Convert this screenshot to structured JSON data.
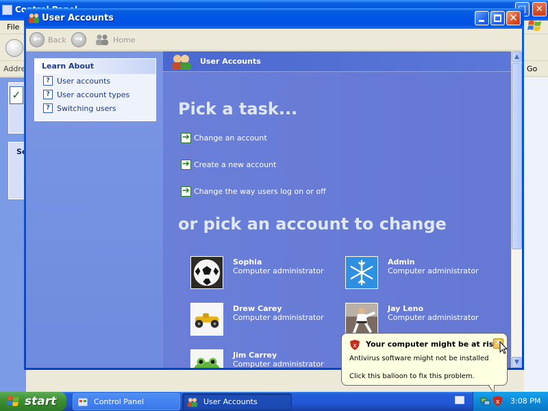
{
  "background_window": {
    "title": "Control Panel",
    "menu_file": "File",
    "address_label": "Address",
    "go_label": "Go",
    "section_prefix": "Se"
  },
  "window": {
    "title": "User Accounts",
    "nav": {
      "back": "Back",
      "home": "Home"
    }
  },
  "learn_about": {
    "heading": "Learn About",
    "items": [
      {
        "label": "User accounts"
      },
      {
        "label": "User account types"
      },
      {
        "label": "Switching users"
      }
    ]
  },
  "main": {
    "header": "User Accounts",
    "pick_task": "Pick a task...",
    "tasks": [
      {
        "label": "Change an account"
      },
      {
        "label": "Create a new account"
      },
      {
        "label": "Change the way users log on or off"
      }
    ],
    "pick_account": "or pick an account to change",
    "accounts": [
      {
        "name": "Sophia",
        "role": "Computer administrator",
        "picture": "soccer-ball-icon"
      },
      {
        "name": "Admin",
        "role": "Computer administrator",
        "picture": "snowflake-icon"
      },
      {
        "name": "Drew Carey",
        "role": "Computer administrator",
        "picture": "race-car-icon"
      },
      {
        "name": "Jay Leno",
        "role": "Computer administrator",
        "picture": "karate-icon"
      },
      {
        "name": "Jim Carrey",
        "role": "Computer administrator",
        "picture": "frog-icon"
      }
    ]
  },
  "balloon": {
    "title": "Your computer might be at risk",
    "line1": "Antivirus software might not be installed",
    "line2": "Click this balloon to fix this problem."
  },
  "taskbar": {
    "start": "start",
    "items": [
      {
        "label": "Control Panel"
      },
      {
        "label": "User Accounts"
      }
    ],
    "clock": "3:08 PM"
  },
  "colors": {
    "xp_blue": "#0055e5",
    "pane_blue": "#6a7fd8",
    "link_blue": "#1c3a8a",
    "start_green": "#3b8f32",
    "balloon_yellow": "#ffffe1"
  }
}
